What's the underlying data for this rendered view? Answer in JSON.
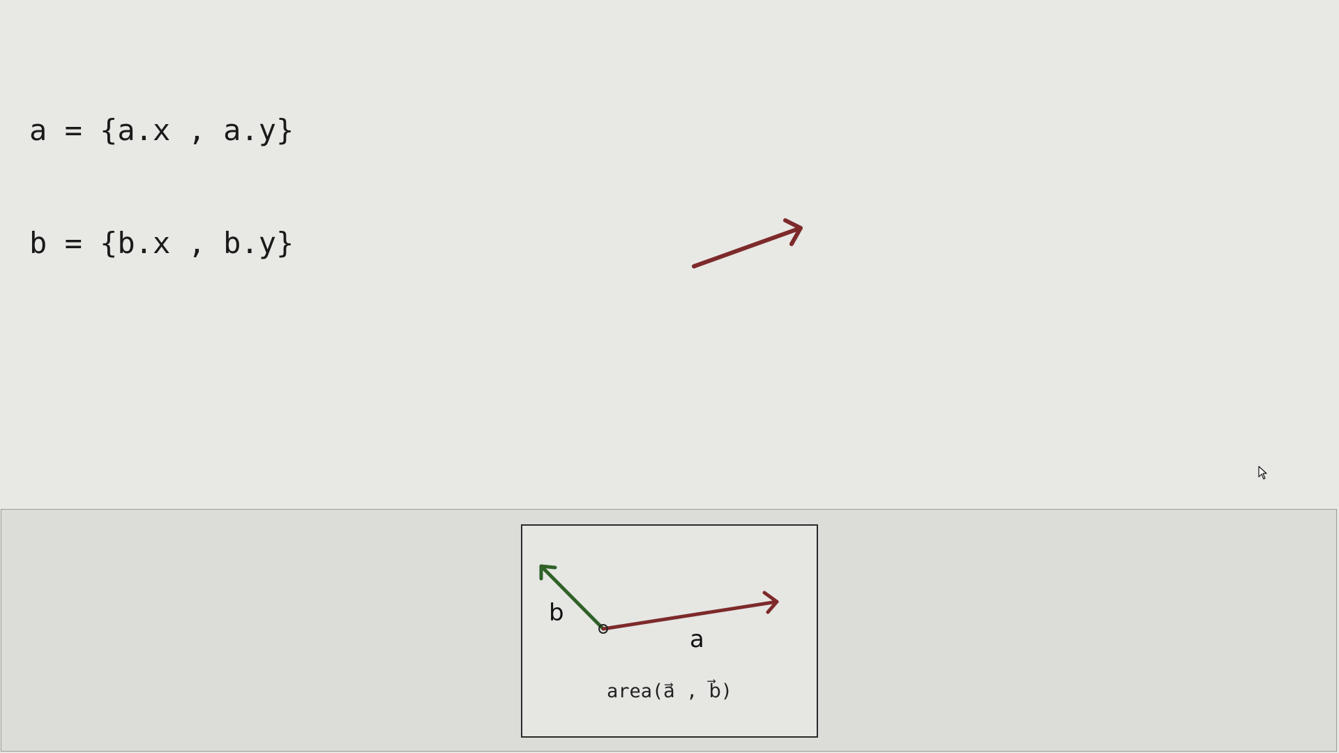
{
  "definitions": {
    "line_a": "a = {a.x , a.y}",
    "line_b": "b = {b.x , b.y}"
  },
  "colors": {
    "vector_a": "#7d2a2a",
    "vector_b": "#2f6128",
    "background": "#e8e8e5",
    "panel": "#dcdcd9"
  },
  "thumbnail": {
    "label_b": "b",
    "label_a": "a",
    "caption": "area(a⃗ , b⃗)"
  },
  "icons": {
    "cursor": "mouse-pointer-icon"
  }
}
